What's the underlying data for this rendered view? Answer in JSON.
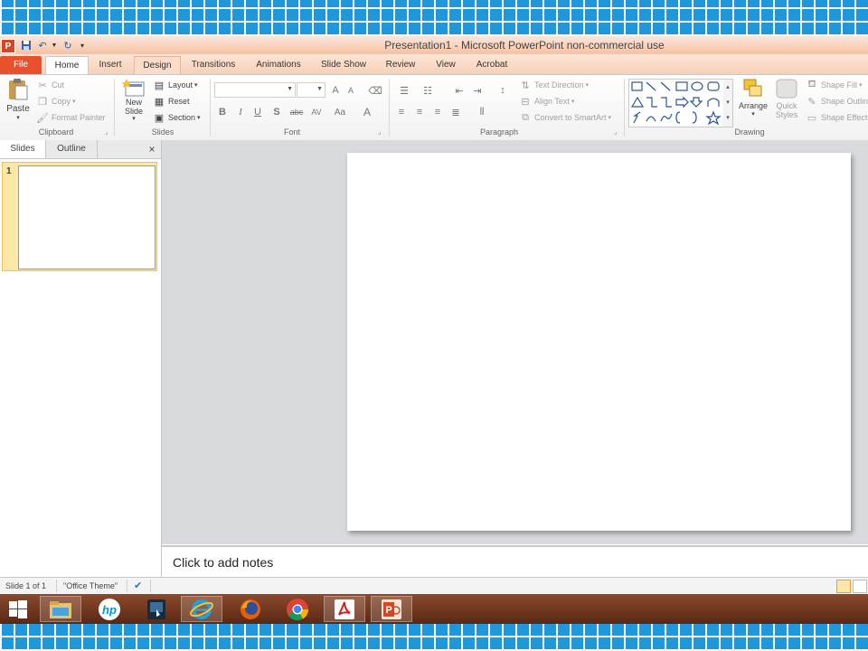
{
  "window": {
    "title": "Presentation1  -  Microsoft PowerPoint non-commercial use",
    "app_icon_letter": "P"
  },
  "ribbon_tabs": [
    {
      "label": "File"
    },
    {
      "label": "Home"
    },
    {
      "label": "Insert"
    },
    {
      "label": "Design"
    },
    {
      "label": "Transitions"
    },
    {
      "label": "Animations"
    },
    {
      "label": "Slide Show"
    },
    {
      "label": "Review"
    },
    {
      "label": "View"
    },
    {
      "label": "Acrobat"
    }
  ],
  "ribbon": {
    "clipboard": {
      "group_label": "Clipboard",
      "paste": "Paste",
      "cut": "Cut",
      "copy": "Copy",
      "format_painter": "Format Painter"
    },
    "slides": {
      "group_label": "Slides",
      "new_slide_line1": "New",
      "new_slide_line2": "Slide",
      "layout": "Layout",
      "reset": "Reset",
      "section": "Section"
    },
    "font": {
      "group_label": "Font",
      "font_name": "",
      "font_size": "",
      "bold": "B",
      "italic": "I",
      "underline": "U",
      "shadow": "S",
      "strikethrough": "abc",
      "spacing": "AV",
      "change_case": "Aa",
      "font_color": "A",
      "grow": "A",
      "shrink": "A"
    },
    "paragraph": {
      "group_label": "Paragraph",
      "text_direction": "Text Direction",
      "align_text": "Align Text",
      "convert_smartart": "Convert to SmartArt"
    },
    "drawing": {
      "group_label": "Drawing",
      "arrange": "Arrange",
      "quick_styles_line1": "Quick",
      "quick_styles_line2": "Styles",
      "shape_fill": "Shape Fill",
      "shape_outline": "Shape Outline",
      "shape_effects": "Shape Effects"
    }
  },
  "left_pane": {
    "tabs": [
      "Slides",
      "Outline"
    ],
    "close_glyph": "×",
    "thumbnail_number": "1"
  },
  "notes": {
    "placeholder": "Click to add notes"
  },
  "status": {
    "slide_count": "Slide 1 of 1",
    "theme": "\"Office Theme\""
  },
  "taskbar": {
    "items": [
      "start-button",
      "file-explorer",
      "hp",
      "app-touch",
      "internet-explorer",
      "firefox",
      "chrome",
      "adobe-reader",
      "powerpoint"
    ]
  },
  "colors": {
    "file_tab": "#e8512b",
    "title_bar": "#f6c2a4",
    "taskbar": "#6b321b",
    "background_pattern": "#1f97db"
  }
}
